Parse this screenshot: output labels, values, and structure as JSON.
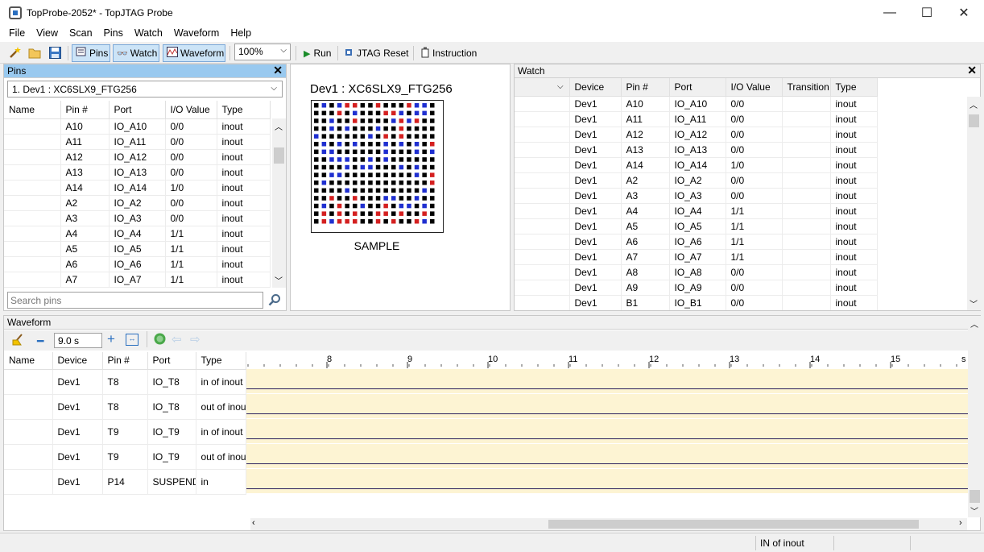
{
  "window": {
    "title": "TopProbe-2052* - TopJTAG Probe",
    "minimize": "—",
    "maximize": "☐",
    "close": "✕"
  },
  "menu": [
    "File",
    "View",
    "Scan",
    "Pins",
    "Watch",
    "Waveform",
    "Help"
  ],
  "toolbar": {
    "pins_label": "Pins",
    "watch_label": "Watch",
    "waveform_label": "Waveform",
    "zoom_value": "100%",
    "run_label": "Run",
    "jtag_reset_label": "JTAG Reset",
    "instruction_label": "Instruction"
  },
  "pins_panel": {
    "title": "Pins",
    "device_select": "1.  Dev1 : XC6SLX9_FTG256",
    "columns": [
      "Name",
      "Pin #",
      "Port",
      "I/O Value",
      "Type"
    ],
    "rows": [
      [
        "",
        "A10",
        "IO_A10",
        "0/0",
        "inout"
      ],
      [
        "",
        "A11",
        "IO_A11",
        "0/0",
        "inout"
      ],
      [
        "",
        "A12",
        "IO_A12",
        "0/0",
        "inout"
      ],
      [
        "",
        "A13",
        "IO_A13",
        "0/0",
        "inout"
      ],
      [
        "",
        "A14",
        "IO_A14",
        "1/0",
        "inout"
      ],
      [
        "",
        "A2",
        "IO_A2",
        "0/0",
        "inout"
      ],
      [
        "",
        "A3",
        "IO_A3",
        "0/0",
        "inout"
      ],
      [
        "",
        "A4",
        "IO_A4",
        "1/1",
        "inout"
      ],
      [
        "",
        "A5",
        "IO_A5",
        "1/1",
        "inout"
      ],
      [
        "",
        "A6",
        "IO_A6",
        "1/1",
        "inout"
      ],
      [
        "",
        "A7",
        "IO_A7",
        "1/1",
        "inout"
      ]
    ],
    "search_placeholder": "Search pins"
  },
  "device_view": {
    "title": "Dev1 : XC6SLX9_FTG256",
    "mode": "SAMPLE",
    "colors": {
      "off": "#000000",
      "high": "#d42020",
      "low": "#1f2fd0"
    }
  },
  "watch_panel": {
    "title": "Watch",
    "columns": [
      "",
      "Device",
      "Pin #",
      "Port",
      "I/O Value",
      "Transition",
      "Type"
    ],
    "rows": [
      [
        "",
        "Dev1",
        "A10",
        "IO_A10",
        "0/0",
        "",
        "inout"
      ],
      [
        "",
        "Dev1",
        "A11",
        "IO_A11",
        "0/0",
        "",
        "inout"
      ],
      [
        "",
        "Dev1",
        "A12",
        "IO_A12",
        "0/0",
        "",
        "inout"
      ],
      [
        "",
        "Dev1",
        "A13",
        "IO_A13",
        "0/0",
        "",
        "inout"
      ],
      [
        "",
        "Dev1",
        "A14",
        "IO_A14",
        "1/0",
        "",
        "inout"
      ],
      [
        "",
        "Dev1",
        "A2",
        "IO_A2",
        "0/0",
        "",
        "inout"
      ],
      [
        "",
        "Dev1",
        "A3",
        "IO_A3",
        "0/0",
        "",
        "inout"
      ],
      [
        "",
        "Dev1",
        "A4",
        "IO_A4",
        "1/1",
        "",
        "inout"
      ],
      [
        "",
        "Dev1",
        "A5",
        "IO_A5",
        "1/1",
        "",
        "inout"
      ],
      [
        "",
        "Dev1",
        "A6",
        "IO_A6",
        "1/1",
        "",
        "inout"
      ],
      [
        "",
        "Dev1",
        "A7",
        "IO_A7",
        "1/1",
        "",
        "inout"
      ],
      [
        "",
        "Dev1",
        "A8",
        "IO_A8",
        "0/0",
        "",
        "inout"
      ],
      [
        "",
        "Dev1",
        "A9",
        "IO_A9",
        "0/0",
        "",
        "inout"
      ],
      [
        "",
        "Dev1",
        "B1",
        "IO_B1",
        "0/0",
        "",
        "inout"
      ]
    ]
  },
  "waveform_panel": {
    "title": "Waveform",
    "zoom_time": "9.0 s",
    "columns": [
      "Name",
      "Device",
      "Pin #",
      "Port",
      "Type"
    ],
    "rows": [
      [
        "",
        "Dev1",
        "T8",
        "IO_T8",
        "in of inout"
      ],
      [
        "",
        "Dev1",
        "T8",
        "IO_T8",
        "out of inout"
      ],
      [
        "",
        "Dev1",
        "T9",
        "IO_T9",
        "in of inout"
      ],
      [
        "",
        "Dev1",
        "T9",
        "IO_T9",
        "out of inout"
      ],
      [
        "",
        "Dev1",
        "P14",
        "SUSPEND",
        "in"
      ]
    ],
    "time_ticks": [
      "8",
      "9",
      "10",
      "11",
      "12",
      "13",
      "14",
      "15"
    ],
    "time_unit": "s"
  },
  "status": {
    "text": "IN of inout"
  }
}
